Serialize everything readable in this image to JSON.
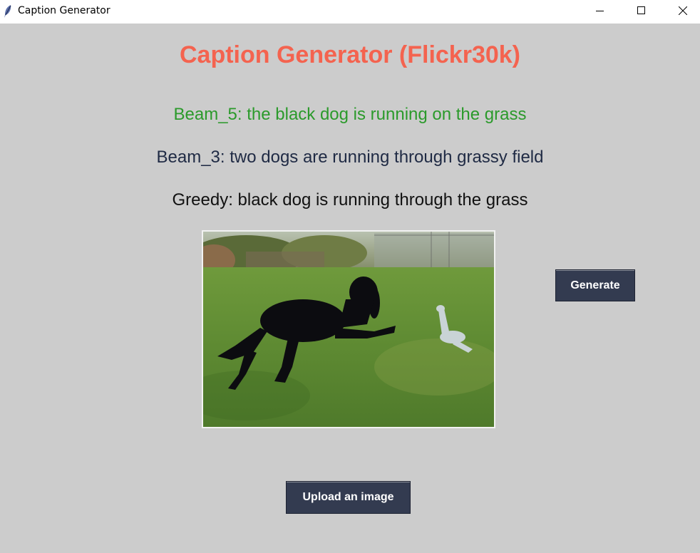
{
  "window": {
    "title": "Caption Generator",
    "controls": [
      "minimize",
      "maximize",
      "close"
    ]
  },
  "app": {
    "heading": "Caption Generator (Flickr30k)",
    "captions": {
      "beam5": "Beam_5: the black dog is running on the grass",
      "beam3": "Beam_3: two dogs are running through grassy field",
      "greedy": "Greedy: black dog is running through the grass"
    },
    "buttons": {
      "generate": "Generate",
      "upload": "Upload an image"
    }
  },
  "colors": {
    "background": "#cccccc",
    "heading": "#f4634f",
    "beam5": "#2b9a2b",
    "beam3": "#1f2a44",
    "greedy": "#111111",
    "button_bg": "#333b50"
  },
  "icons": [
    "feather-icon",
    "minimize-icon",
    "maximize-icon",
    "close-icon"
  ]
}
